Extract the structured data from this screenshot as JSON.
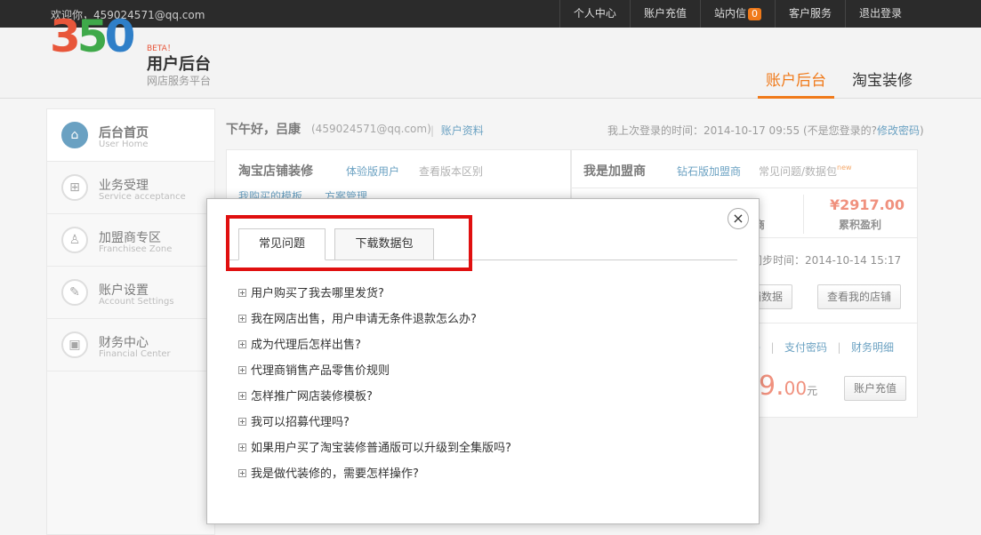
{
  "topbar": {
    "welcome": "欢迎你，459024571@qq.com",
    "nav": [
      {
        "label": "个人中心"
      },
      {
        "label": "账户充值"
      },
      {
        "label": "站内信",
        "badge": "0"
      },
      {
        "label": "客户服务"
      },
      {
        "label": "退出登录"
      }
    ]
  },
  "header": {
    "logo": {
      "d1": "3",
      "d2": "5",
      "d3": "0",
      "beta": "BETA！",
      "title": "用户后台",
      "subtitle": "网店服务平台"
    },
    "tabs": [
      {
        "label": "账户后台",
        "active": true
      },
      {
        "label": "淘宝装修",
        "active": false
      }
    ]
  },
  "sidebar": {
    "items": [
      {
        "label": "后台首页",
        "en": "User Home",
        "icon": "home-icon"
      },
      {
        "label": "业务受理",
        "en": "Service acceptance",
        "icon": "service-icon"
      },
      {
        "label": "加盟商专区",
        "en": "Franchisee Zone",
        "icon": "franchise-icon"
      },
      {
        "label": "账户设置",
        "en": "Account Settings",
        "icon": "edit-icon"
      },
      {
        "label": "财务中心",
        "en": "Financial Center",
        "icon": "briefcase-icon"
      }
    ]
  },
  "main": {
    "greeting": "下午好，吕康",
    "email": "(459024571@qq.com)",
    "sep": "|",
    "account_link": "账户资料",
    "last_login": "我上次登录的时间：2014-10-17 09:55 (不是您登录的?",
    "change_pwd": "修改密码",
    "close_paren": ")",
    "left_panel": {
      "title": "淘宝店铺装修",
      "link1": "体验版用户",
      "link2": "查看版本区别",
      "sub1": "我购买的模板",
      "sub2": "方案管理"
    },
    "right_panel": {
      "title": "我是加盟商",
      "link1": "钻石版加盟商",
      "link2": "常见问题/数据包",
      "new_tag": "new",
      "partial_label": "商",
      "amount": "¥2917.00",
      "amount_label": "累积盈利",
      "sync": "据同步时间：2014-10-14 15:17",
      "btn_data": "铺数据",
      "btn_view_store": "查看我的店铺",
      "link_pwd_partial": "码",
      "link_pay_pwd": "支付密码",
      "link_finance": "财务明细",
      "balance_partial": "9.",
      "balance_cents": "00",
      "balance_unit": "元",
      "btn_recharge": "账户充值"
    }
  },
  "modal": {
    "close": "×",
    "tabs": [
      {
        "label": "常见问题",
        "active": true
      },
      {
        "label": "下载数据包",
        "active": false
      }
    ],
    "faq": [
      "用户购买了我去哪里发货?",
      "我在网店出售，用户申请无条件退款怎么办?",
      "成为代理后怎样出售?",
      "代理商销售产品零售价规则",
      "怎样推广网店装修模板?",
      "我可以招募代理吗?",
      "如果用户买了淘宝装修普通版可以升级到全集版吗?",
      "我是做代装修的，需要怎样操作?"
    ]
  }
}
